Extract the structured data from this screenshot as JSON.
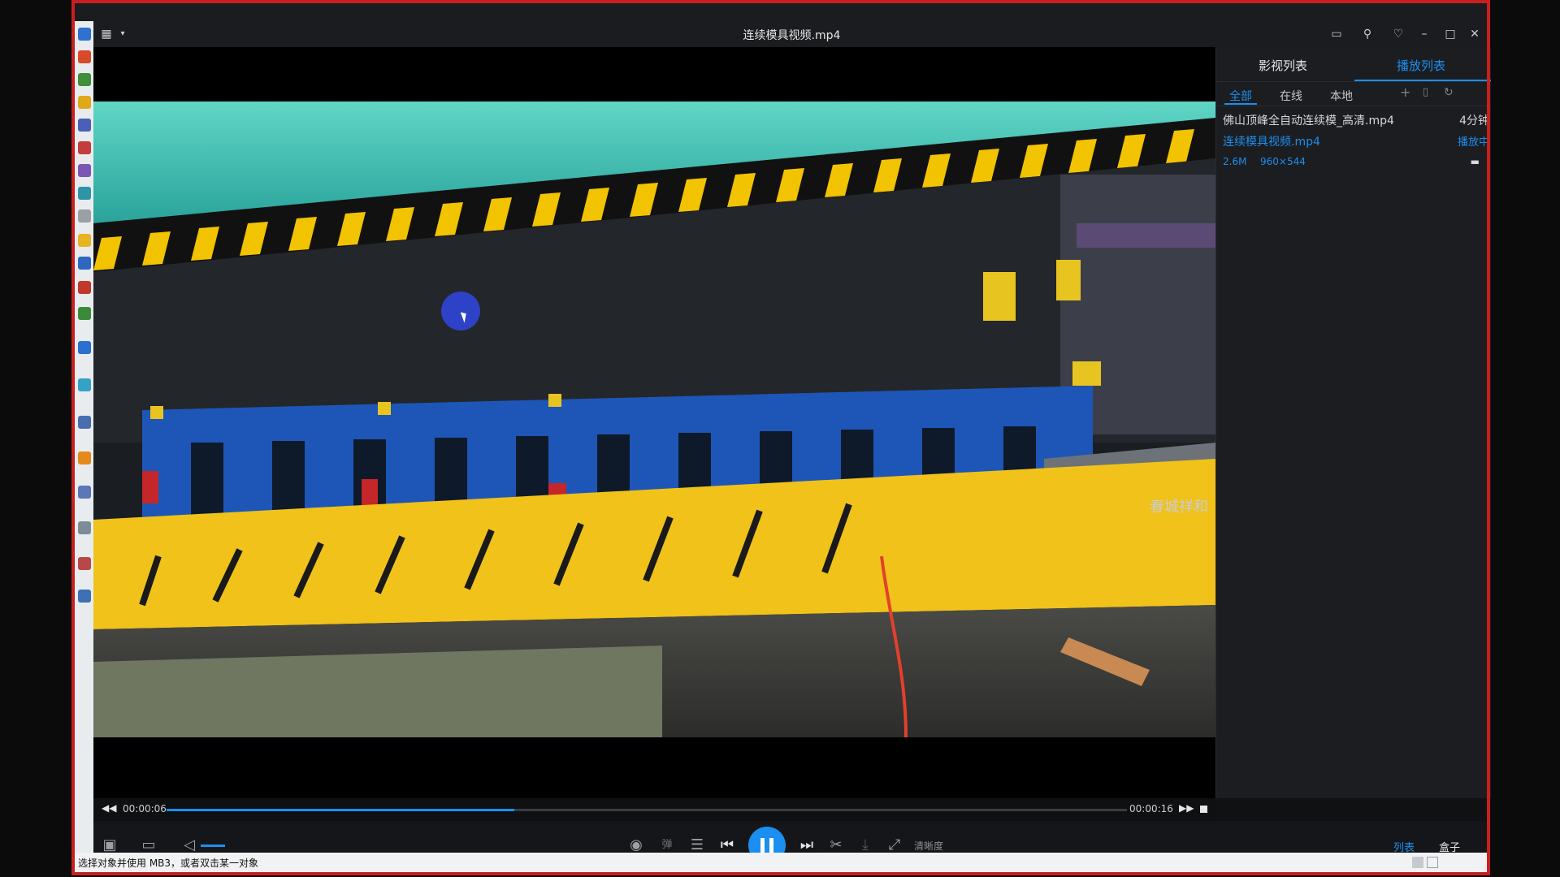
{
  "window": {
    "title": "连续模具视频.mp4"
  },
  "side_panel": {
    "tabs": [
      {
        "label": "影视列表",
        "active": false
      },
      {
        "label": "播放列表",
        "active": true
      }
    ],
    "subtabs": [
      {
        "label": "全部",
        "active": true
      },
      {
        "label": "在线",
        "active": false
      },
      {
        "label": "本地",
        "active": false
      }
    ],
    "items": [
      {
        "name": "佛山顶峰全自动连续模_高清.mp4",
        "duration": "4分钟"
      },
      {
        "name": "连续模具视频.mp4",
        "status": "播放中",
        "size": "2.6M",
        "resolution": "960×544",
        "active": true
      }
    ]
  },
  "player": {
    "current_time": "00:00:06",
    "total_time": "00:00:16",
    "progress": 0.362,
    "quality_label": "清晰度",
    "danmaku_label": "弹",
    "list_label": "列表",
    "box_label": "盒子"
  },
  "status_bar": {
    "text": "选择对象并使用 MB3，或者双击某一对象"
  },
  "colors": {
    "accent": "#1b8ff0",
    "frame_red": "#c8201f",
    "machine_yellow": "#f2c300",
    "machine_blue": "#1e56b7"
  }
}
